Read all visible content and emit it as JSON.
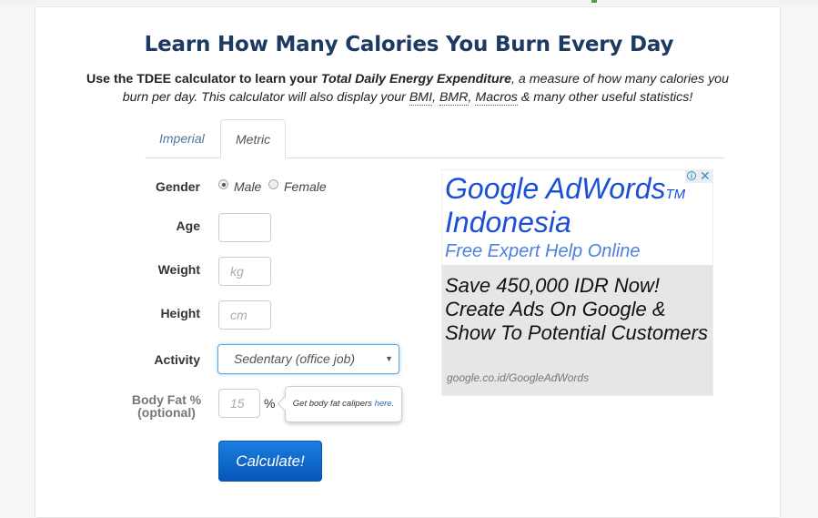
{
  "header": {
    "title": "Learn How Many Calories You Burn Every Day",
    "intro": {
      "lead_bold": "Use the TDEE calculator to learn your ",
      "term": "Total Daily Energy Expenditure",
      "rest1": ", a measure of how many calories you burn per day. This calculator will also display your ",
      "bmi": "BMI",
      "sep1": ", ",
      "bmr": "BMR",
      "sep2": ", ",
      "macros": "Macros",
      "rest2": " & many other useful statistics!"
    }
  },
  "tabs": [
    {
      "label": "Imperial",
      "active": false
    },
    {
      "label": "Metric",
      "active": true
    }
  ],
  "form": {
    "gender": {
      "label": "Gender",
      "options": [
        {
          "label": "Male",
          "checked": true
        },
        {
          "label": "Female",
          "checked": false
        }
      ]
    },
    "age": {
      "label": "Age",
      "value": "",
      "placeholder": ""
    },
    "weight": {
      "label": "Weight",
      "value": "",
      "placeholder": "kg"
    },
    "height": {
      "label": "Height",
      "value": "",
      "placeholder": "cm"
    },
    "activity": {
      "label": "Activity",
      "selected": "Sedentary (office job)"
    },
    "body_fat": {
      "label_line1": "Body Fat %",
      "label_line2": "(optional)",
      "placeholder": "15",
      "unit": "%"
    },
    "tooltip": {
      "text": "Get body fat calipers ",
      "link": "here",
      "suffix": "."
    },
    "calculate_label": "Calculate!"
  },
  "ad": {
    "headline": "Google AdWords",
    "headline_tm": "TM",
    "headline2": "Indonesia",
    "subline": "Free Expert Help Online",
    "body": "Save 450,000 IDR Now! Create Ads On Google & Show To Potential Customers",
    "url": "google.co.id/GoogleAdWords",
    "info_icon": "i",
    "close_icon": "✕"
  },
  "colors": {
    "title": "#1d3a63",
    "link": "#4a7aa3",
    "button": "#0b6ad0",
    "ad_headline": "#1a4fd6"
  }
}
